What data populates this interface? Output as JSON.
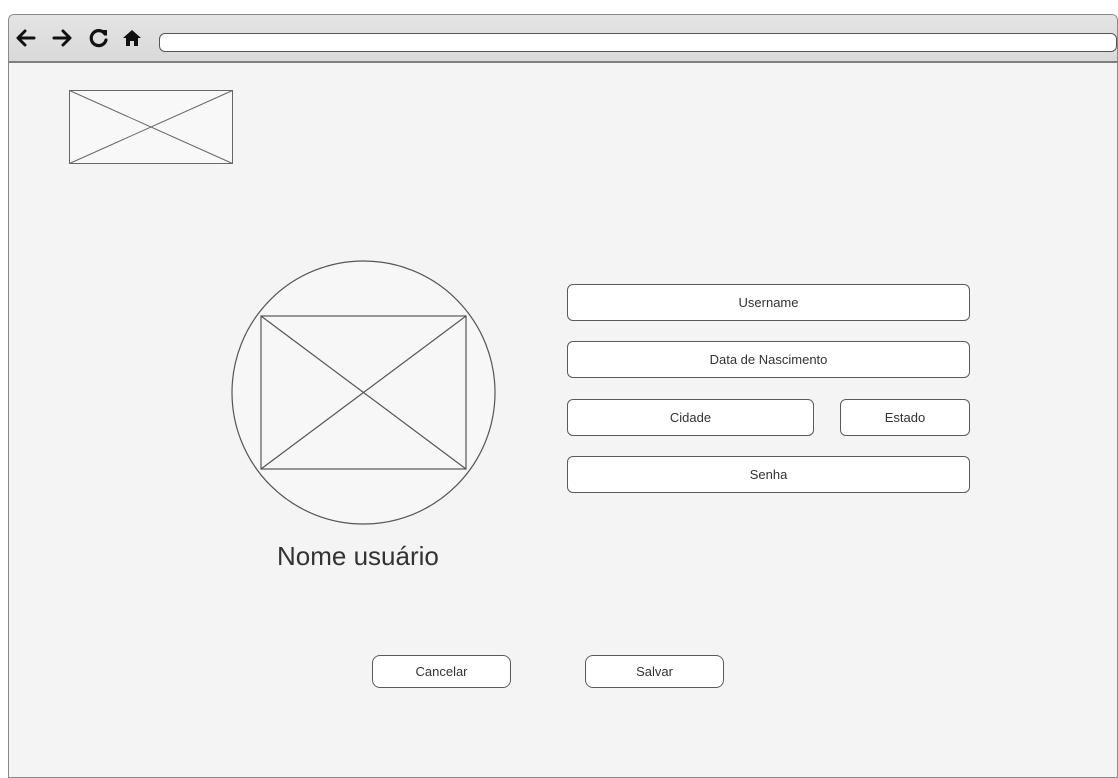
{
  "browser": {
    "toolbar_icons": [
      "back-icon",
      "forward-icon",
      "reload-icon",
      "home-icon"
    ],
    "address_value": ""
  },
  "logo_placeholder": {
    "icon": "image-placeholder-icon"
  },
  "profile": {
    "avatar_icon": "image-placeholder-icon",
    "name": "Nome usuário"
  },
  "form": {
    "username": "Username",
    "birth_date": "Data de Nascimento",
    "city": "Cidade",
    "state": "Estado",
    "password": "Senha"
  },
  "actions": {
    "cancel_label": "Cancelar",
    "save_label": "Salvar"
  },
  "colors": {
    "background": "#f4f4f4",
    "toolbar": "#dcdcdc",
    "outline": "#5a5a5a",
    "text": "#333333"
  }
}
